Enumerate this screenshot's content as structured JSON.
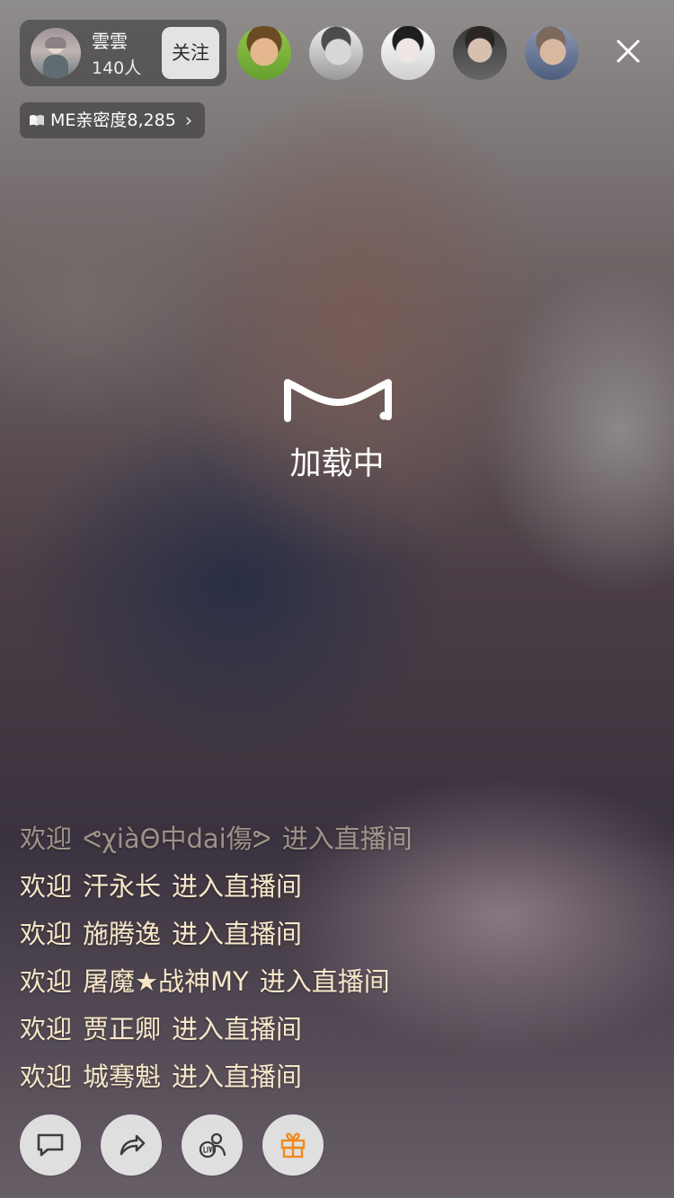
{
  "host": {
    "name": "雲雲",
    "viewer_count": "140人",
    "follow_label": "关注"
  },
  "intimacy": {
    "text": "ME亲密度8,285",
    "chevron": "›"
  },
  "loading": {
    "text": "加载中"
  },
  "welcome_messages": [
    {
      "prefix": "欢迎",
      "user": "ᕙχiàΘ中dai傷ᕗ",
      "suffix": "进入直播间"
    },
    {
      "prefix": "欢迎",
      "user": "汗永长",
      "suffix": "进入直播间"
    },
    {
      "prefix": "欢迎",
      "user": "施腾逸",
      "suffix": "进入直播间"
    },
    {
      "prefix": "欢迎",
      "user": "屠魔★战神MY",
      "suffix": "进入直播间"
    },
    {
      "prefix": "欢迎",
      "user": "贾正卿",
      "suffix": "进入直播间"
    },
    {
      "prefix": "欢迎",
      "user": "城骞魁",
      "suffix": "进入直播间"
    }
  ],
  "icons": {
    "close": "close-icon",
    "chat": "chat-icon",
    "share": "share-icon",
    "live": "live-people-icon",
    "gift": "gift-icon"
  },
  "colors": {
    "message_text": "#f7e7c8",
    "gift": "#f08a1d"
  }
}
